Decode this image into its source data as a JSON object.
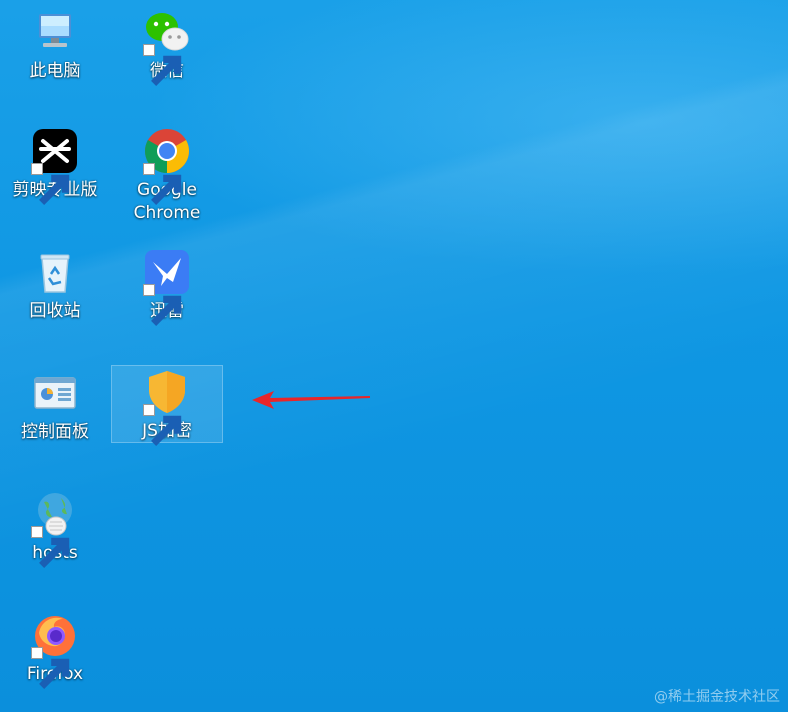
{
  "desktop": {
    "icons": [
      {
        "label": "此电脑",
        "icon": "computer-icon",
        "shortcut": false
      },
      {
        "label": "微信",
        "icon": "wechat-icon",
        "shortcut": true
      },
      {
        "label": "剪映专业版",
        "icon": "capcut-icon",
        "shortcut": true
      },
      {
        "label": "Google\nChrome",
        "icon": "chrome-icon",
        "shortcut": true
      },
      {
        "label": "回收站",
        "icon": "recycle-bin-icon",
        "shortcut": false
      },
      {
        "label": "迅雷",
        "icon": "thunder-icon",
        "shortcut": true
      },
      {
        "label": "控制面板",
        "icon": "control-panel-icon",
        "shortcut": false
      },
      {
        "label": "JS加密",
        "icon": "shield-icon",
        "shortcut": true,
        "selected": true
      },
      {
        "label": "hosts",
        "icon": "globe-document-icon",
        "shortcut": true
      },
      {
        "label": "Firefox",
        "icon": "firefox-icon",
        "shortcut": true
      }
    ]
  },
  "annotation": {
    "arrow_color": "#e8262a",
    "points_to": "JS加密"
  },
  "colors": {
    "desktop_blue": "#0f97e3"
  },
  "watermark": "@稀土掘金技术社区"
}
